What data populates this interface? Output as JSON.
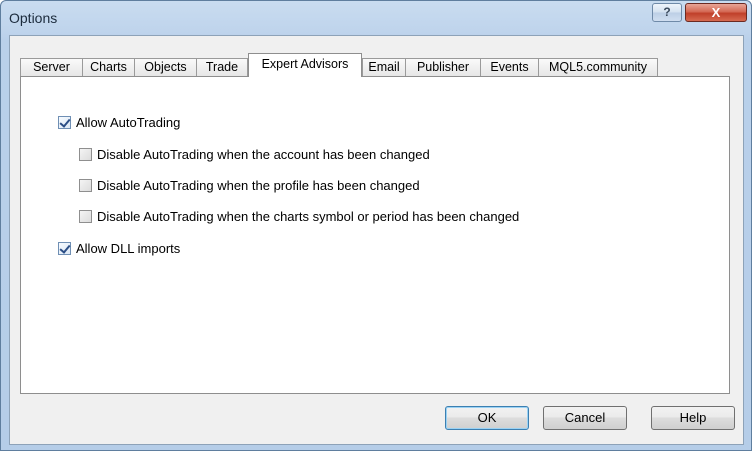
{
  "window": {
    "title": "Options",
    "help_glyph": "?",
    "close_glyph": "X"
  },
  "tabs": [
    {
      "label": "Server"
    },
    {
      "label": "Charts"
    },
    {
      "label": "Objects"
    },
    {
      "label": "Trade"
    },
    {
      "label": "Expert Advisors",
      "active": true
    },
    {
      "label": "Email"
    },
    {
      "label": "Publisher"
    },
    {
      "label": "Events"
    },
    {
      "label": "MQL5.community"
    }
  ],
  "options": {
    "allow_autotrading": {
      "label": "Allow AutoTrading",
      "checked": true
    },
    "disable_account_changed": {
      "label": "Disable AutoTrading when the account has been changed",
      "checked": false
    },
    "disable_profile_changed": {
      "label": "Disable AutoTrading when the profile has been changed",
      "checked": false
    },
    "disable_symbol_changed": {
      "label": "Disable AutoTrading when the charts symbol or period has been changed",
      "checked": false
    },
    "allow_dll_imports": {
      "label": "Allow DLL imports",
      "checked": true
    }
  },
  "buttons": {
    "ok": "OK",
    "cancel": "Cancel",
    "help": "Help"
  }
}
